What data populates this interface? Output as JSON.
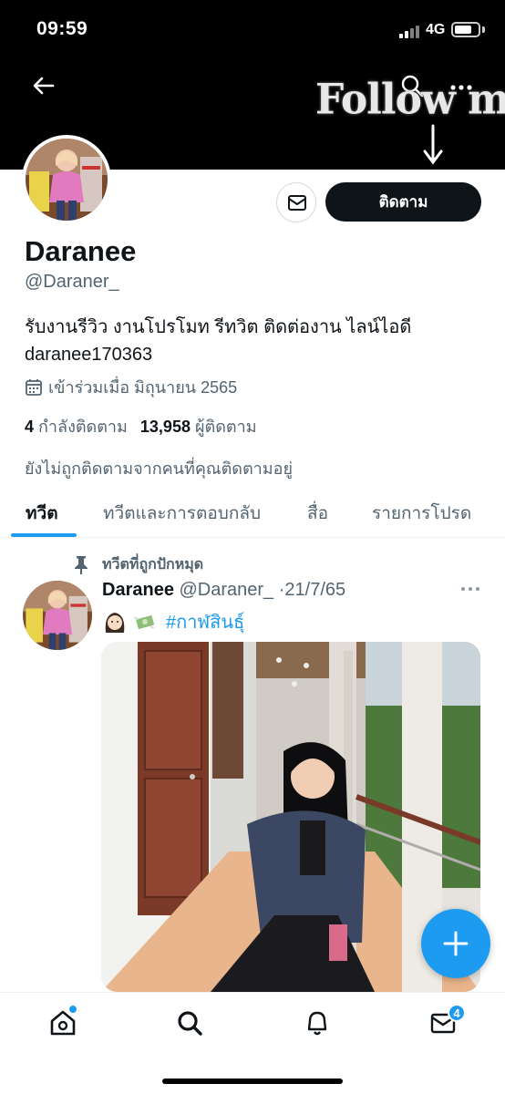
{
  "status_bar": {
    "time": "09:59",
    "network": "4G",
    "battery_level": 0.75
  },
  "banner": {
    "text": "Follow me"
  },
  "profile": {
    "display_name": "Daranee",
    "handle": "@Daraner_",
    "bio_line1": "รับงานรีวิว งานโปรโมท รีทวิต ติดต่องาน ไลน์ไอดี",
    "bio_line2": "daranee170363",
    "joined": "เข้าร่วมเมื่อ มิถุนายน 2565",
    "following_count": "4",
    "following_label": "กำลังติดตาม",
    "followers_count": "13,958",
    "followers_label": "ผู้ติดตาม",
    "not_followed_text": "ยังไม่ถูกติดตามจากคนที่คุณติดตามอยู่",
    "follow_button_label": "ติดตาม"
  },
  "tabs": [
    {
      "label": "ทวีต",
      "active": true
    },
    {
      "label": "ทวีตและการตอบกลับ",
      "active": false
    },
    {
      "label": "สื่อ",
      "active": false
    },
    {
      "label": "รายการโปรด",
      "active": false
    }
  ],
  "tweet": {
    "pinned_label": "ทวีตที่ถูกปักหมุด",
    "author_name": "Daranee",
    "author_handle": "@Daraner_",
    "separator": "·",
    "date": "21/7/65",
    "hashtag": "#กาฬสินธุ์"
  },
  "bottom_nav": {
    "items": [
      "home-icon",
      "search-icon",
      "bell-icon",
      "mail-icon"
    ],
    "mail_badge": "4"
  },
  "colors": {
    "accent": "#1d9bf0",
    "text_primary": "#0f1419",
    "text_secondary": "#536471",
    "follow_button": "#0f1419"
  }
}
